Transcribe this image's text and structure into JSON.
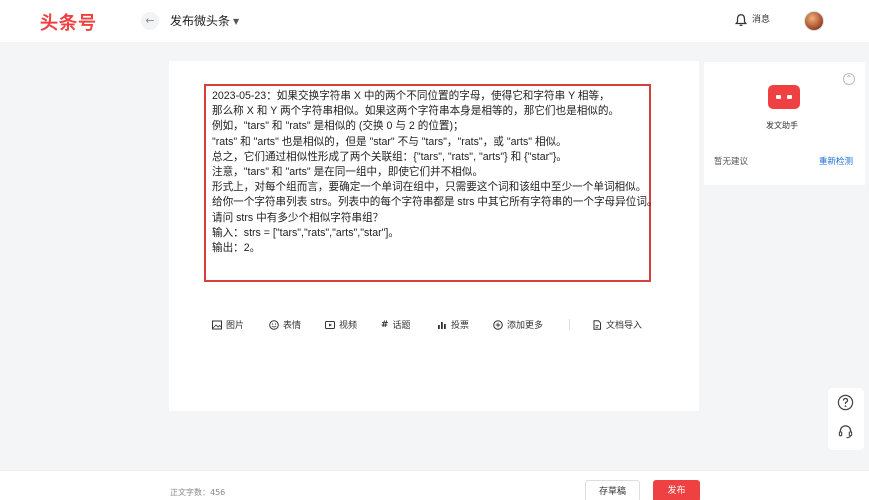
{
  "header": {
    "logo": "头条号",
    "back_icon": "arrow-left-icon",
    "title": "发布微头条",
    "messages_label": "消息"
  },
  "editor": {
    "lines": [
      "2023-05-23：如果交换字符串 X 中的两个不同位置的字母，使得它和字符串 Y 相等，",
      "那么称 X 和 Y 两个字符串相似。如果这两个字符串本身是相等的，那它们也是相似的。",
      "例如，\"tars\" 和 \"rats\" 是相似的 (交换 0 与 2 的位置)；",
      "\"rats\" 和 \"arts\" 也是相似的，但是 \"star\" 不与 \"tars\"，\"rats\"，或 \"arts\" 相似。",
      "总之，它们通过相似性形成了两个关联组：{\"tars\", \"rats\", \"arts\"} 和 {\"star\"}。",
      "注意，\"tars\" 和 \"arts\" 是在同一组中，即使它们并不相似。",
      "形式上，对每个组而言，要确定一个单词在组中，只需要这个词和该组中至少一个单词相似。",
      "给你一个字符串列表 strs。列表中的每个字符串都是 strs 中其它所有字符串的一个字母异位词。",
      "请问 strs 中有多少个相似字符串组？",
      "输入：strs = [\"tars\",\"rats\",\"arts\",\"star\"]。",
      "输出：2。"
    ]
  },
  "toolbar": {
    "image": "图片",
    "emoji": "表情",
    "video": "视频",
    "topic": "话题",
    "poll": "投票",
    "more": "添加更多",
    "import": "文档导入"
  },
  "assistant": {
    "name": "发文助手",
    "no_suggestion": "暂无建议",
    "recheck": "重新检测"
  },
  "footer": {
    "word_count": "正文字数：456",
    "draft": "存草稿",
    "publish": "发布"
  },
  "colors": {
    "brand": "#f04142",
    "highlight_border": "#d6403a",
    "link": "#1e6fd9"
  }
}
